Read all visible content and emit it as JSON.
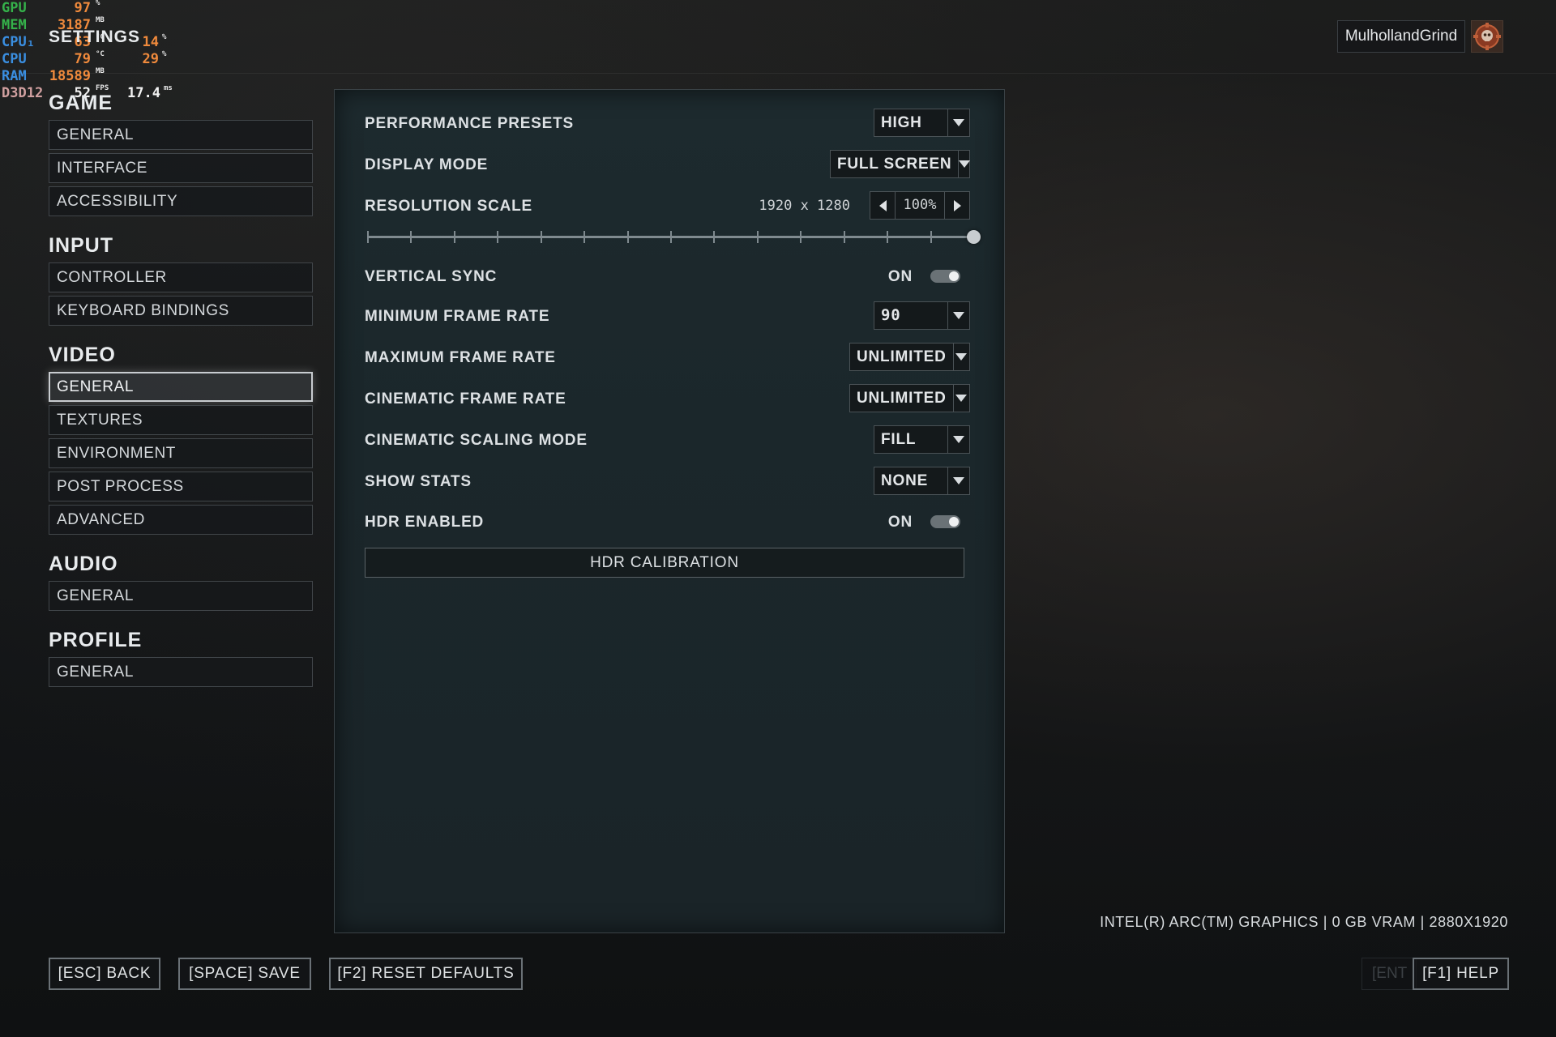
{
  "perf_overlay": {
    "rows": [
      {
        "label": "GPU",
        "value": "97",
        "unit": "%",
        "value2": "",
        "unit2": ""
      },
      {
        "label": "MEM",
        "value": "3187",
        "unit": "MB",
        "value2": "",
        "unit2": ""
      },
      {
        "label": "CPU₁",
        "value": "63",
        "unit": "°C",
        "value2": "14",
        "unit2": "%"
      },
      {
        "label": "CPU",
        "value": "79",
        "unit": "°C",
        "value2": "29",
        "unit2": "%"
      },
      {
        "label": "RAM",
        "value": "18589",
        "unit": "MB",
        "value2": "",
        "unit2": ""
      },
      {
        "label": "D3D12",
        "value": "52",
        "unit": "FPS",
        "value2": "17.4",
        "unit2": "ms"
      }
    ]
  },
  "page_title": "SETTINGS",
  "user": {
    "name": "MulhollandGrind",
    "avatar_icon": "gear-skull-emblem-icon"
  },
  "nav": {
    "sections": [
      {
        "heading": "GAME",
        "items": [
          "GENERAL",
          "INTERFACE",
          "ACCESSIBILITY"
        ]
      },
      {
        "heading": "INPUT",
        "items": [
          "CONTROLLER",
          "KEYBOARD BINDINGS"
        ]
      },
      {
        "heading": "VIDEO",
        "items": [
          "GENERAL",
          "TEXTURES",
          "ENVIRONMENT",
          "POST PROCESS",
          "ADVANCED"
        ]
      },
      {
        "heading": "AUDIO",
        "items": [
          "GENERAL"
        ]
      },
      {
        "heading": "PROFILE",
        "items": [
          "GENERAL"
        ]
      }
    ],
    "active": "VIDEO / GENERAL"
  },
  "settings": {
    "performance_presets": {
      "label": "PERFORMANCE PRESETS",
      "value": "HIGH"
    },
    "display_mode": {
      "label": "DISPLAY MODE",
      "value": "FULL SCREEN"
    },
    "resolution_scale": {
      "label": "RESOLUTION SCALE",
      "resolution": "1920 x 1280",
      "percent": "100%",
      "slider_fraction": 1.0,
      "slider_steps": 14
    },
    "vertical_sync": {
      "label": "VERTICAL SYNC",
      "state": "ON"
    },
    "minimum_frame_rate": {
      "label": "MINIMUM FRAME RATE",
      "value": "90"
    },
    "maximum_frame_rate": {
      "label": "MAXIMUM FRAME RATE",
      "value": "UNLIMITED"
    },
    "cinematic_frame_rate": {
      "label": "CINEMATIC FRAME RATE",
      "value": "UNLIMITED"
    },
    "cinematic_scaling_mode": {
      "label": "CINEMATIC SCALING MODE",
      "value": "FILL"
    },
    "show_stats": {
      "label": "SHOW STATS",
      "value": "NONE"
    },
    "hdr_enabled": {
      "label": "HDR ENABLED",
      "state": "ON"
    },
    "hdr_calibration_label": "HDR CALIBRATION"
  },
  "gpu_info": "INTEL(R) ARC(TM) GRAPHICS | 0 GB VRAM | 2880X1920",
  "footer": {
    "back": "[ESC] BACK",
    "save": "[SPACE] SAVE",
    "reset": "[F2] RESET DEFAULTS",
    "ghost": "[ENT",
    "help": "[F1] HELP"
  },
  "colors": {
    "accent_orange": "#f08a3c",
    "gpu_green": "#35b14a",
    "cpu_blue": "#3a8ee0"
  }
}
